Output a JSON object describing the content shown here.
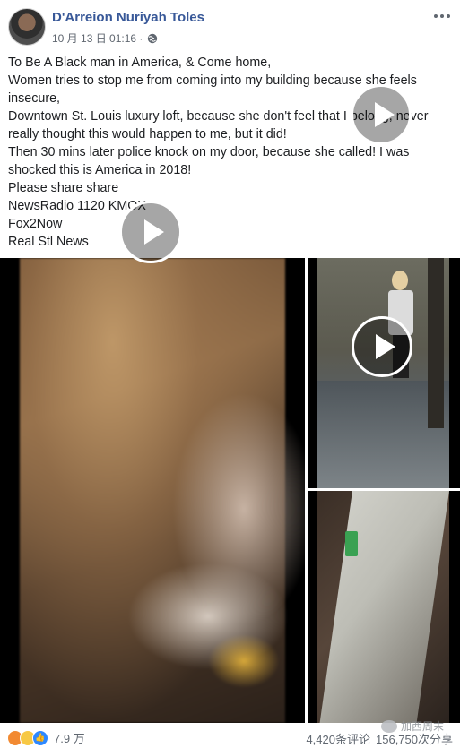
{
  "post": {
    "author": "D'Arreion Nuriyah Toles",
    "timestamp": "10 月 13 日 01:16 ·",
    "lines": [
      "To Be A Black man in America, & Come home,",
      "Women tries to stop me from coming into my building because she feels insecure,",
      "Downtown St. Louis luxury loft, because she don't feel that I belong, never really thought this would happen to me, but it did!",
      "Then 30 mins later police knock on my door, because she called! I was shocked this is America in 2018!",
      "Please share share",
      "NewsRadio 1120 KMOX",
      "Fox2Now",
      "Real Stl News"
    ]
  },
  "icons": {
    "privacy": "globe-icon",
    "menu": "more-icon",
    "video": "play-icon"
  },
  "reactions": {
    "count": "7.9 万"
  },
  "stats": {
    "comments": "4,420条评论",
    "shares": "156,750次分享"
  },
  "watermark": "加西周末",
  "colors": {
    "author_link": "#385898",
    "like": "#2d88ff",
    "angry": "#f28a32",
    "wow": "#f7c844"
  }
}
